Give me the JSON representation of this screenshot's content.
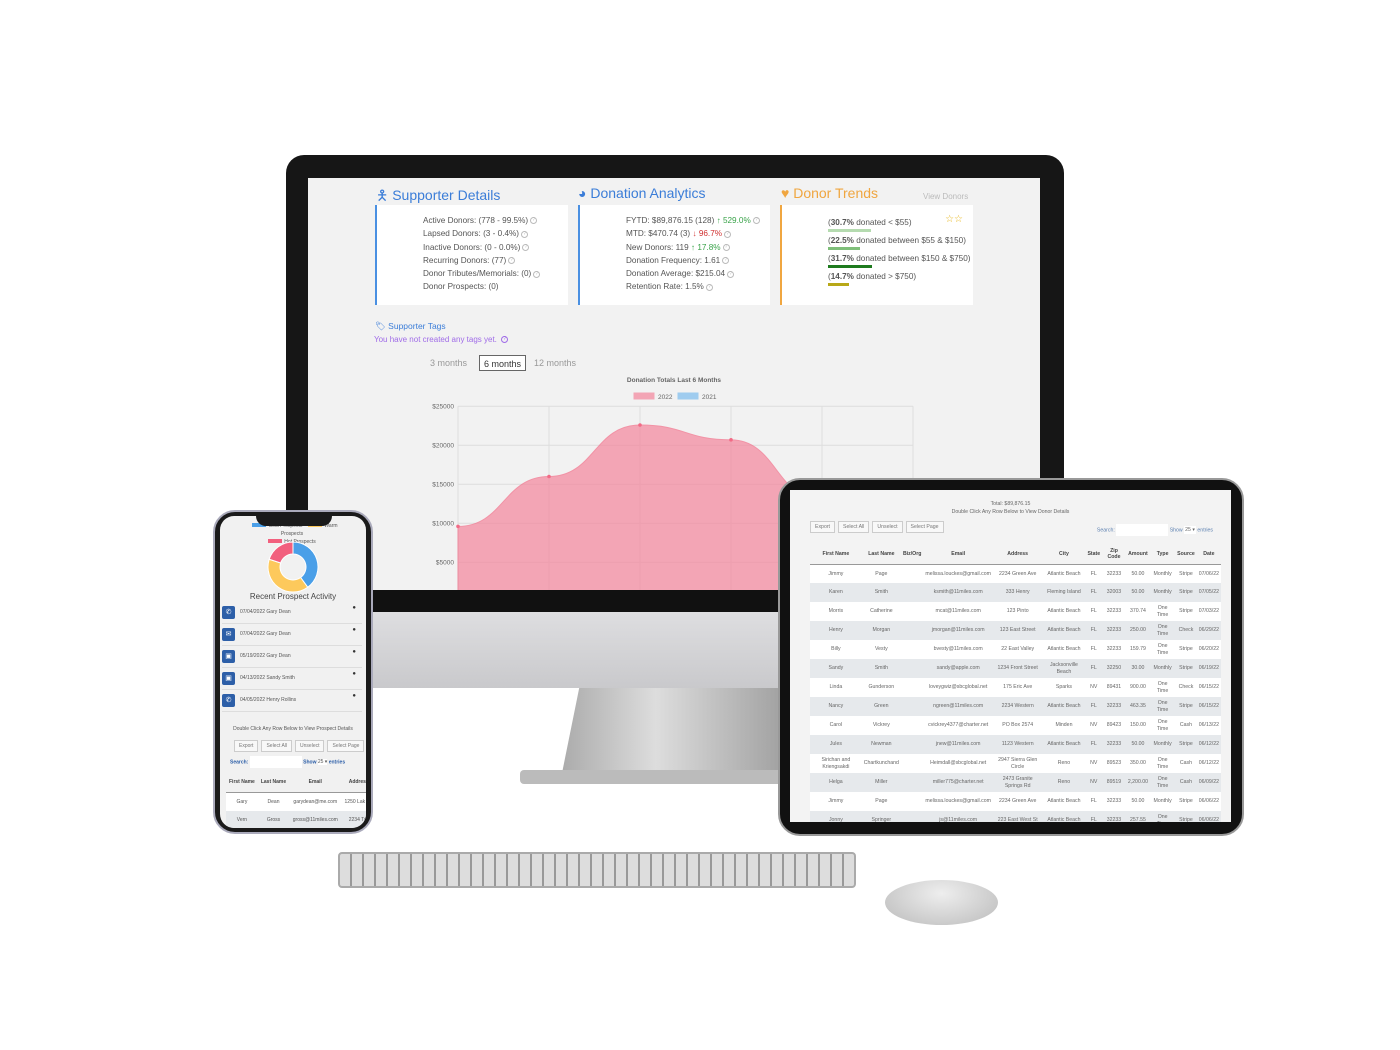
{
  "supporter_details": {
    "title": "Supporter Details",
    "icon": "person-icon",
    "items": [
      "Active Donors: (778 - 99.5%)",
      "Lapsed Donors: (3 - 0.4%)",
      "Inactive Donors: (0 - 0.0%)",
      "Recurring Donors: (77)",
      "Donor Tributes/Memorials: (0)",
      "Donor Prospects: (0)"
    ]
  },
  "donation_analytics": {
    "title": "Donation Analytics",
    "icon": "pie-chart-icon",
    "items": [
      {
        "text": "FYTD: $89,876.15 (128)",
        "change": "529.0%",
        "dir": "up"
      },
      {
        "text": "MTD: $470.74 (3)",
        "change": "96.7%",
        "dir": "down"
      },
      {
        "text": "New Donors: 119",
        "change": "17.8%",
        "dir": "up"
      },
      {
        "text": "Donation Frequency: 1.61"
      },
      {
        "text": "Donation Average: $215.04"
      },
      {
        "text": "Retention Rate: 1.5%"
      }
    ]
  },
  "donor_trends": {
    "title": "Donor Trends",
    "icon": "heart-icon",
    "view_link": "View Donors",
    "items": [
      {
        "pct": "30.7%",
        "text": " donated < $55",
        "color": "#b5dbb0"
      },
      {
        "pct": "22.5%",
        "text": " donated between $55 & $150",
        "color": "#7fbf7a"
      },
      {
        "pct": "31.7%",
        "text": " donated between $150 & $750",
        "color": "#1e7a1e"
      },
      {
        "pct": "14.7%",
        "text": " donated > $750",
        "color": "#b8a818"
      }
    ]
  },
  "supporter_tags": {
    "title": "Supporter Tags",
    "empty": "You have not created any tags yet."
  },
  "range_tabs": [
    "3 months",
    "6 months",
    "12 months"
  ],
  "active_tab": "6 months",
  "chart_data": {
    "type": "area",
    "title": "Donation Totals Last 6 Months",
    "series": [
      {
        "name": "2022",
        "color": "#f4859c",
        "values": [
          9600,
          16000,
          22600,
          20700
        ]
      },
      {
        "name": "2021",
        "color": "#7cbcee",
        "values": []
      }
    ],
    "yticks": [
      "$25000",
      "$20000",
      "$15000",
      "$10000",
      "$5000"
    ],
    "ylim": [
      0,
      25000
    ],
    "grid": true,
    "legend": "top"
  },
  "tablet": {
    "total": "Total: $89,876.15",
    "hint": "Double Click Any Row Below to View Donor Details",
    "buttons": [
      "Export",
      "Select All",
      "Unselect",
      "Select Page"
    ],
    "search_label": "Search:",
    "show_label": "Show",
    "show_value": "25",
    "entries_label": "entries",
    "columns": [
      "First Name",
      "Last Name",
      "Biz/Org",
      "Email",
      "Address",
      "City",
      "State",
      "Zip Code",
      "Amount",
      "Type",
      "Source",
      "Date"
    ],
    "rows": [
      [
        "Jimmy",
        "Page",
        "",
        "melissa.louckes@gmail.com",
        "2234 Green Ave",
        "Atlantic Beach",
        "FL",
        "32233",
        "50.00",
        "Monthly",
        "Stripe",
        "07/06/22"
      ],
      [
        "Karen",
        "Smith",
        "",
        "ksmith@11miles.com",
        "333 Henry",
        "Fleming Island",
        "FL",
        "32003",
        "50.00",
        "Monthly",
        "Stripe",
        "07/05/22"
      ],
      [
        "Morris",
        "Catherine",
        "",
        "mcat@11miles.com",
        "123 Pinto",
        "Atlantic Beach",
        "FL",
        "32233",
        "370.74",
        "One Time",
        "Stripe",
        "07/03/22"
      ],
      [
        "Henry",
        "Morgan",
        "",
        "jmorgan@11miles.com",
        "123 East Street",
        "Atlantic Beach",
        "FL",
        "32233",
        "250.00",
        "One Time",
        "Check",
        "06/29/22"
      ],
      [
        "Billy",
        "Vesty",
        "",
        "bvesty@11miles.com",
        "22 East Valley",
        "Atlantic Beach",
        "FL",
        "32233",
        "159.79",
        "One Time",
        "Stripe",
        "06/20/22"
      ],
      [
        "Sandy",
        "Smith",
        "",
        "sandy@apple.com",
        "1234 Front Street",
        "Jacksonville Beach",
        "FL",
        "32250",
        "30.00",
        "Monthly",
        "Stripe",
        "06/19/22"
      ],
      [
        "Linda",
        "Gunderson",
        "",
        "loveygwiz@sbcglobal.net",
        "175 Eric Ave",
        "Sparks",
        "NV",
        "89431",
        "900.00",
        "One Time",
        "Check",
        "06/15/22"
      ],
      [
        "Nancy",
        "Green",
        "",
        "ngreen@11miles.com",
        "2234 Western",
        "Atlantic Beach",
        "FL",
        "32233",
        "463.35",
        "One Time",
        "Stripe",
        "06/15/22"
      ],
      [
        "Carol",
        "Vickrey",
        "",
        "cvickrey4377@charter.net",
        "PO Box 2574",
        "Minden",
        "NV",
        "89423",
        "150.00",
        "One Time",
        "Cash",
        "06/13/22"
      ],
      [
        "Jules",
        "Newman",
        "",
        "jnew@11miles.com",
        "1123 Western",
        "Atlantic Beach",
        "FL",
        "32233",
        "50.00",
        "Monthly",
        "Stripe",
        "06/12/22"
      ],
      [
        "Sirichan and Kriengsakdi",
        "Chartkunchand",
        "",
        "Heimdall@sbcglobal.net",
        "2947 Sierra Glen Circle",
        "Reno",
        "NV",
        "89523",
        "350.00",
        "One Time",
        "Cash",
        "06/12/22"
      ],
      [
        "Helga",
        "Miller",
        "",
        "miller775@charter.net",
        "2473 Granite Springs Rd",
        "Reno",
        "NV",
        "89519",
        "2,200.00",
        "One Time",
        "Cash",
        "06/09/22"
      ],
      [
        "Jimmy",
        "Page",
        "",
        "melissa.louckes@gmail.com",
        "2234 Green Ave",
        "Atlantic Beach",
        "FL",
        "32233",
        "50.00",
        "Monthly",
        "Stripe",
        "06/06/22"
      ],
      [
        "Jonny",
        "Springer",
        "",
        "js@11miles.com",
        "223 East West St",
        "Atlantic Beach",
        "FL",
        "32233",
        "257.55",
        "One Time",
        "Stripe",
        "06/06/22"
      ]
    ]
  },
  "phone": {
    "legend": [
      "Cold Prospects",
      "Warm Prospects",
      "Hot Prospects"
    ],
    "legend_colors": [
      "#4a9fe8",
      "#fdc95c",
      "#f2607e"
    ],
    "donut": [
      40,
      40,
      20
    ],
    "activity_title": "Recent Prospect Activity",
    "activity": [
      {
        "icon": "phone-icon",
        "glyph": "✆",
        "date": "07/04/2022",
        "name": "Gary Dean"
      },
      {
        "icon": "envelope-icon",
        "glyph": "✉",
        "date": "07/04/2022",
        "name": "Gary Dean"
      },
      {
        "icon": "meeting-icon",
        "glyph": "▣",
        "date": "05/19/2022",
        "name": "Gary Dean"
      },
      {
        "icon": "meeting-icon",
        "glyph": "▣",
        "date": "04/13/2022",
        "name": "Sandy Smith"
      },
      {
        "icon": "phone-icon",
        "glyph": "✆",
        "date": "04/05/2022",
        "name": "Henry Rollins"
      }
    ],
    "hint": "Double Click Any Row Below to View Prospect Details",
    "buttons": [
      "Export",
      "Select All",
      "Unselect",
      "Select Page"
    ],
    "search_label": "Search:",
    "show_label": "Show",
    "show_value": "25",
    "entries_label": "entries",
    "columns": [
      "First Name",
      "Last Name",
      "Email",
      "Address"
    ],
    "rows": [
      [
        "Gary",
        "Dean",
        "garydean@me.com",
        "1250 Lak Dr."
      ],
      [
        "Vern",
        "Gross",
        "gross@11miles.com",
        "2234 Twi"
      ]
    ]
  }
}
